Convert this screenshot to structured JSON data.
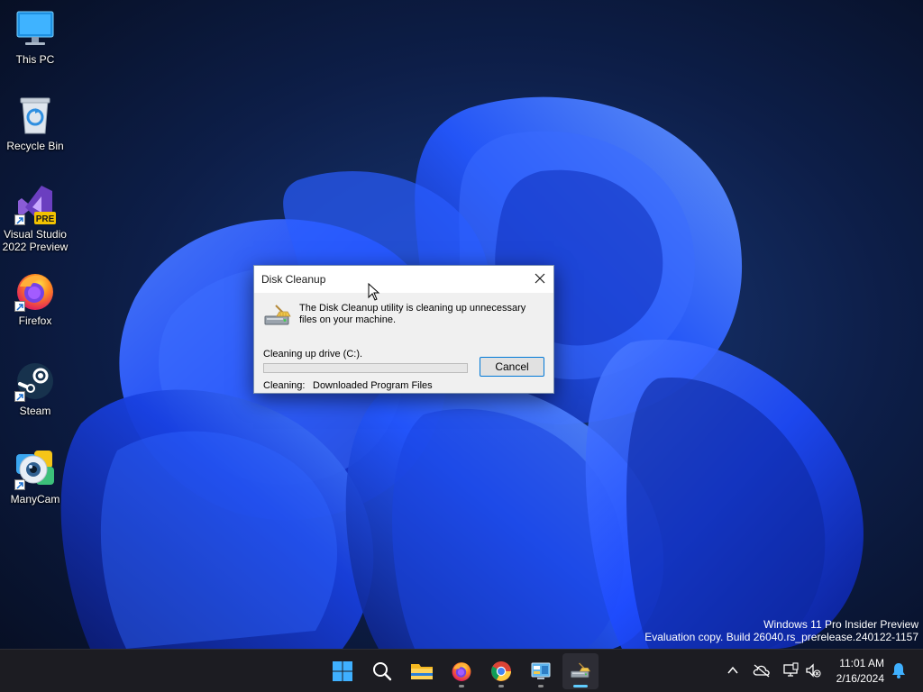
{
  "desktop": {
    "icons": [
      {
        "label": "This PC",
        "icon": "computer-monitor-icon"
      },
      {
        "label": "Recycle Bin",
        "icon": "recycle-bin-icon"
      },
      {
        "label": "Visual Studio 2022 Preview",
        "icon": "visual-studio-icon",
        "badge": "PRE"
      },
      {
        "label": "Firefox",
        "icon": "firefox-icon"
      },
      {
        "label": "Steam",
        "icon": "steam-icon"
      },
      {
        "label": "ManyCam",
        "icon": "manycam-icon"
      }
    ]
  },
  "dialog": {
    "title": "Disk Cleanup",
    "message": "The Disk Cleanup utility is cleaning up unnecessary files on your machine.",
    "drive_label": "Cleaning up drive  (C:).",
    "progress_percent": 0,
    "cancel_label": "Cancel",
    "cleaning_label": "Cleaning:",
    "cleaning_value": "Downloaded Program Files",
    "icon": "disk-cleanup-icon"
  },
  "watermark": {
    "line1": "Windows 11 Pro Insider Preview",
    "line2": "Evaluation copy. Build 26040.rs_prerelease.240122-1157"
  },
  "taskbar": {
    "apps": [
      {
        "name": "start-button",
        "icon": "windows-logo-icon"
      },
      {
        "name": "search-button",
        "icon": "search-icon"
      },
      {
        "name": "file-explorer",
        "icon": "folder-icon"
      },
      {
        "name": "firefox",
        "icon": "firefox-icon"
      },
      {
        "name": "chrome",
        "icon": "chrome-icon"
      },
      {
        "name": "control-panel",
        "icon": "control-panel-icon"
      },
      {
        "name": "disk-cleanup",
        "icon": "disk-cleanup-icon"
      }
    ],
    "tray": {
      "time": "11:01 AM",
      "date": "2/16/2024"
    }
  },
  "colors": {
    "accent": "#0078d7",
    "taskbar_bg": "#1c1c22",
    "active_indicator": "#60cdff"
  }
}
